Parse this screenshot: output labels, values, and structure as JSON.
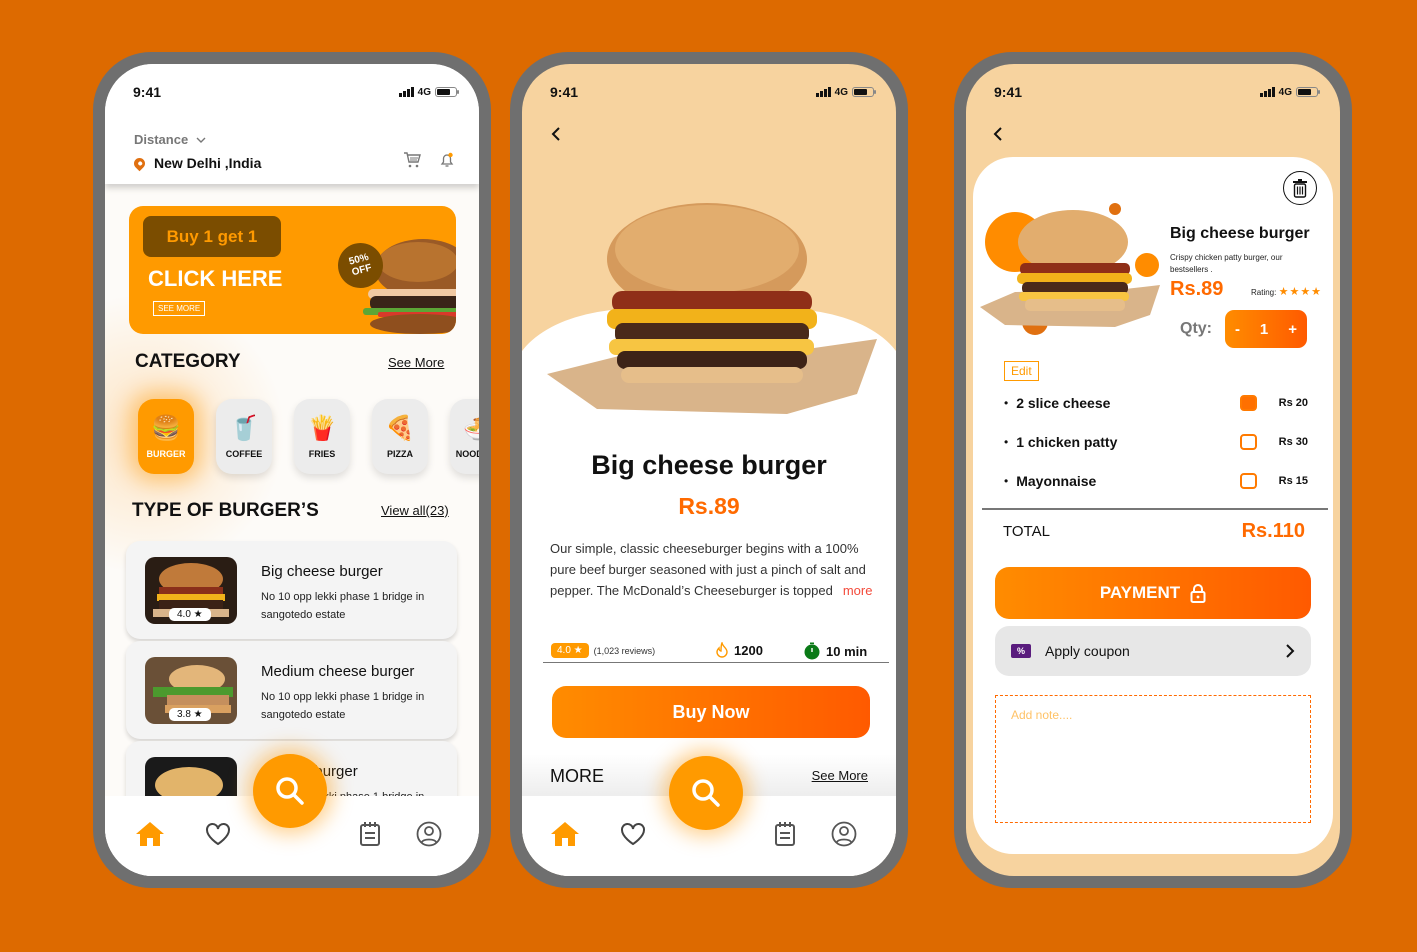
{
  "status_bar": {
    "time": "9:41",
    "network": "4G",
    "battery_level": 0.7
  },
  "home": {
    "distance_label": "Distance",
    "location": "New Delhi ,India",
    "promo": {
      "pill": "Buy 1 get 1",
      "headline": "CLICK HERE",
      "see_more": "SEE MORE",
      "badge_line1": "50%",
      "badge_line2": "OFF"
    },
    "category": {
      "title": "CATEGORY",
      "link": "See More",
      "items": [
        {
          "label": "BURGER",
          "emoji": "🍔",
          "active": true
        },
        {
          "label": "COFFEE",
          "emoji": "🥤"
        },
        {
          "label": "FRIES",
          "emoji": "🍟"
        },
        {
          "label": "PIZZA",
          "emoji": "🍕"
        },
        {
          "label": "NOODLES",
          "emoji": "🍜"
        }
      ]
    },
    "types": {
      "title": "TYPE OF BURGER’S",
      "link": "View all(23)",
      "items": [
        {
          "name": "Big cheese burger",
          "address": "No 10 opp lekki phase 1 bridge in sangotedo estate",
          "rating": "4.0 ★"
        },
        {
          "name": "Medium cheese burger",
          "address": "No 10 opp lekki phase 1 bridge in sangotedo estate",
          "rating": "3.8 ★"
        },
        {
          "name": "... patty burger",
          "address": "No 10 opp lekki phase 1 bridge in sangotedo estate",
          "rating": ""
        }
      ]
    }
  },
  "detail": {
    "title": "Big cheese burger",
    "price": "Rs.89",
    "description": "Our simple, classic cheeseburger begins with a 100% pure beef burger seasoned with just a pinch of salt and pepper. The McDonald’s Cheeseburger is topped",
    "more_link": "more",
    "rating": "4.0 ★",
    "reviews": "(1,023 reviews)",
    "calories": "1200",
    "time": "10 min",
    "buy_button": "Buy Now",
    "more_title": "MORE",
    "more_see": "See More"
  },
  "cart": {
    "name": "Big cheese burger",
    "subtitle": "Crispy chicken patty burger, our bestsellers .",
    "price": "Rs.89",
    "rating_label": "Rating:",
    "rating_stars": 4,
    "rating_text": "★★★★",
    "qty_label": "Qty:",
    "qty": "1",
    "minus": "-",
    "plus": "+",
    "edit": "Edit",
    "addons": [
      {
        "name": "2 slice cheese",
        "price": "Rs 20",
        "checked": true
      },
      {
        "name": "1 chicken patty",
        "price": "Rs 30",
        "checked": false
      },
      {
        "name": "Mayonnaise",
        "price": "Rs 15",
        "checked": false
      }
    ],
    "total_label": "TOTAL",
    "total": "Rs.110",
    "payment_button": "PAYMENT",
    "coupon": "Apply coupon",
    "note_placeholder": "Add note...."
  },
  "colors": {
    "accent": "#ff9a00",
    "accent_deep": "#ff5a00",
    "background": "#dd6a00",
    "cream": "#f7d39f",
    "frame": "#6f6f6f"
  }
}
